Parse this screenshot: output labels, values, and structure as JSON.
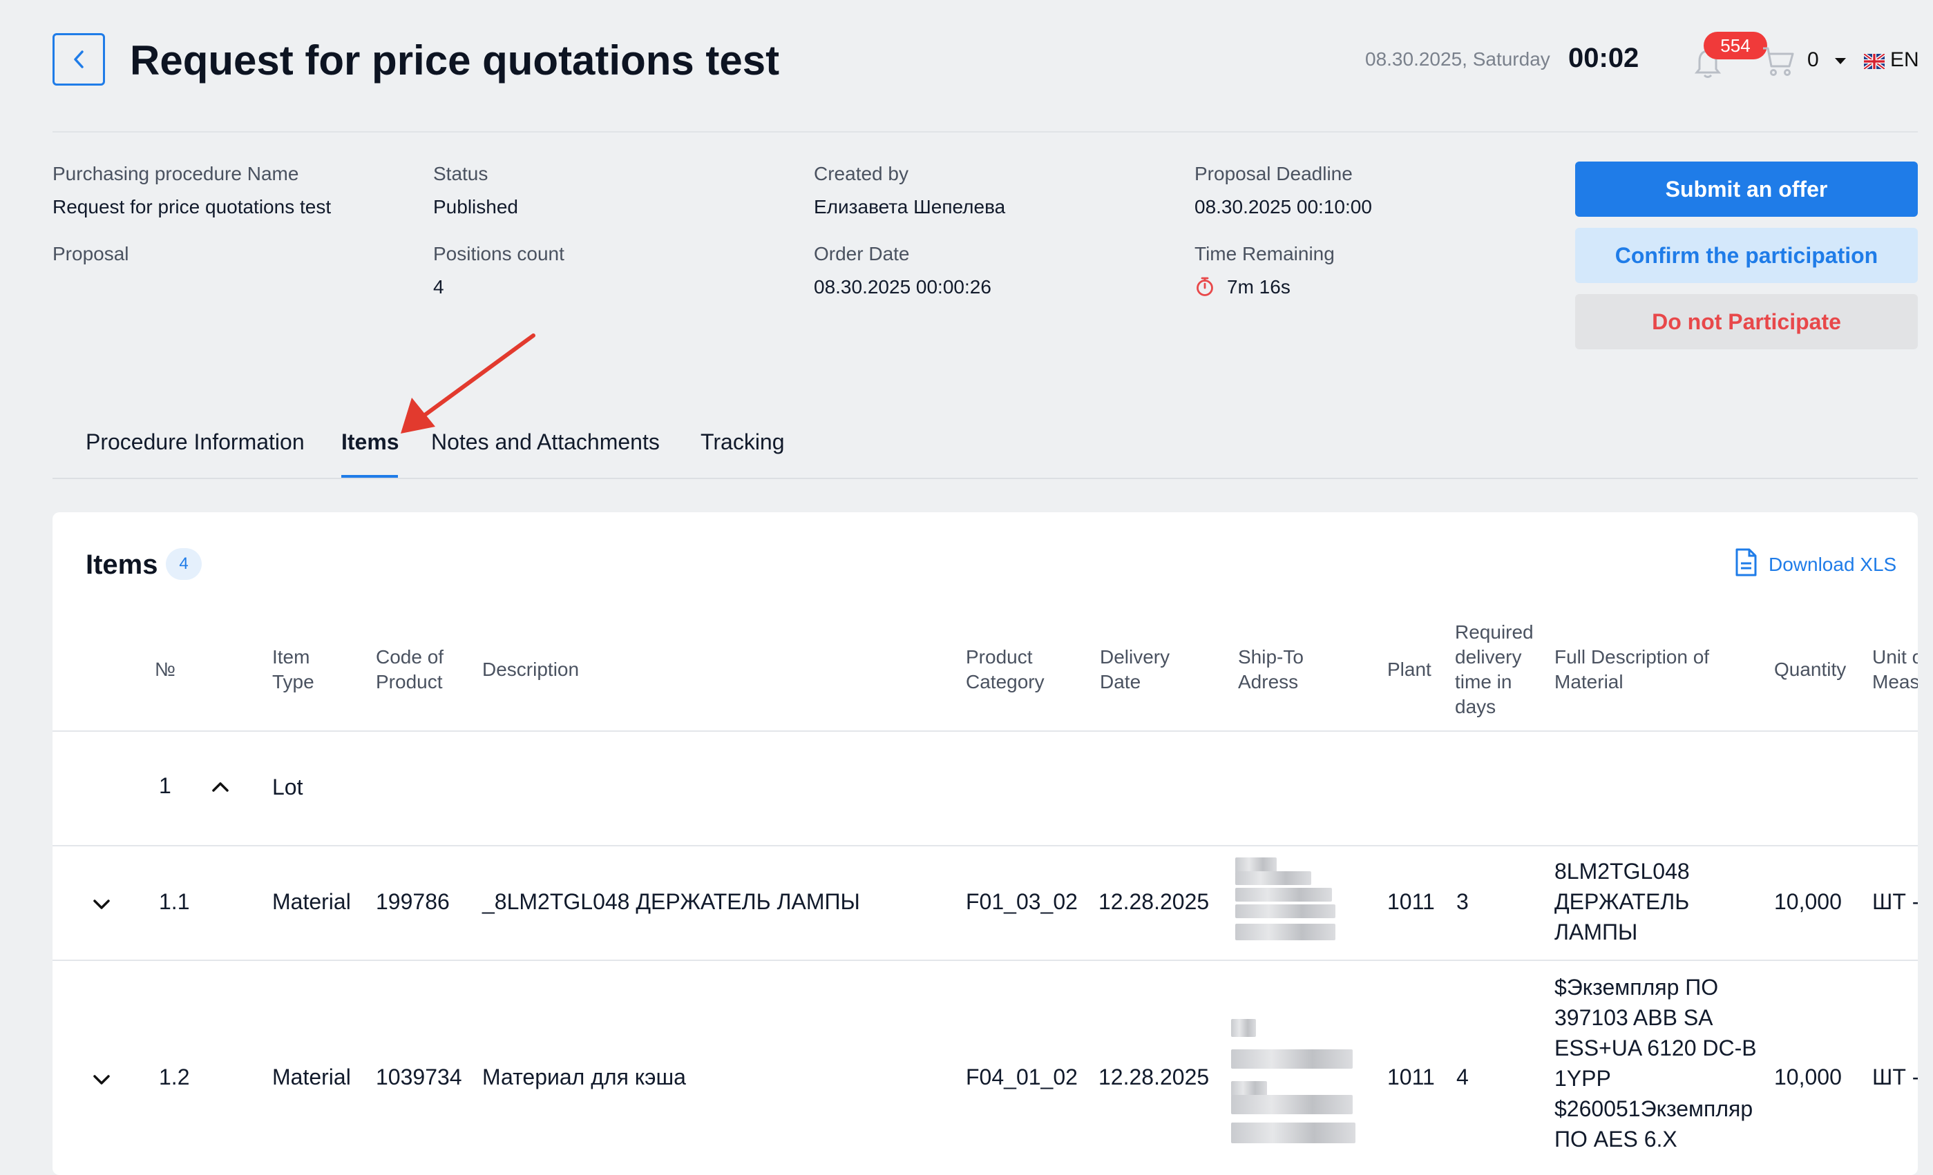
{
  "header": {
    "title": "Request for price quotations test",
    "date": "08.30.2025, Saturday",
    "time": "00:02",
    "notifications": "554",
    "cart_count": "0",
    "language": "EN"
  },
  "info": {
    "procedure_name_label": "Purchasing procedure Name",
    "procedure_name_value": "Request for price quotations test",
    "status_label": "Status",
    "status_value": "Published",
    "created_by_label": "Created by",
    "created_by_value": "Елизавета Шепелева",
    "deadline_label": "Proposal Deadline",
    "deadline_value": "08.30.2025 00:10:00",
    "proposal_label": "Proposal",
    "positions_label": "Positions count",
    "positions_value": "4",
    "order_date_label": "Order Date",
    "order_date_value": "08.30.2025 00:00:26",
    "time_remaining_label": "Time Remaining",
    "time_remaining_value": "7m 16s"
  },
  "actions": {
    "submit": "Submit an offer",
    "confirm": "Confirm the participation",
    "decline": "Do not Participate"
  },
  "tabs": [
    {
      "label": "Procedure Information"
    },
    {
      "label": "Items"
    },
    {
      "label": "Notes and Attachments"
    },
    {
      "label": "Tracking"
    }
  ],
  "items_card": {
    "title": "Items",
    "count": "4",
    "download": "Download XLS",
    "columns": {
      "no": "№",
      "item_type": "Item Type",
      "code": "Code of Product",
      "description": "Description",
      "category": "Product Category",
      "delivery_date": "Delivery Date",
      "ship_to": "Ship-To Adress",
      "plant": "Plant",
      "required_time": "Required delivery time in days",
      "full_desc": "Full Description of Material",
      "quantity": "Quantity",
      "unit": "Unit of Meas"
    },
    "lot_row": {
      "no": "1",
      "type": "Lot"
    },
    "rows": [
      {
        "no": "1.1",
        "type": "Material",
        "code": "199786",
        "description": "_8LM2TGL048 ДЕРЖАТЕЛЬ ЛАМПЫ",
        "category": "F01_03_02",
        "delivery": "12.28.2025",
        "plant": "1011",
        "days": "3",
        "full_desc": [
          "8LM2TGL048",
          "ДЕРЖАТЕЛЬ",
          "ЛАМПЫ"
        ],
        "quantity": "10,000",
        "unit": "ШТ -"
      },
      {
        "no": "1.2",
        "type": "Material",
        "code": "1039734",
        "description": "Материал для кэша",
        "category": "F04_01_02",
        "delivery": "12.28.2025",
        "plant": "1011",
        "days": "4",
        "full_desc": [
          "$Экземпляр ПО",
          "397103 ABB SA",
          "ESS+UA 6120 DC-B",
          "1YPP",
          "$260051Экземпляр",
          "ПО AES 6.X"
        ],
        "quantity": "10,000",
        "unit": "ШТ -"
      }
    ]
  },
  "colors": {
    "accent": "#1f7ce8",
    "danger": "#e8484a",
    "badge": "#f03a3a"
  }
}
